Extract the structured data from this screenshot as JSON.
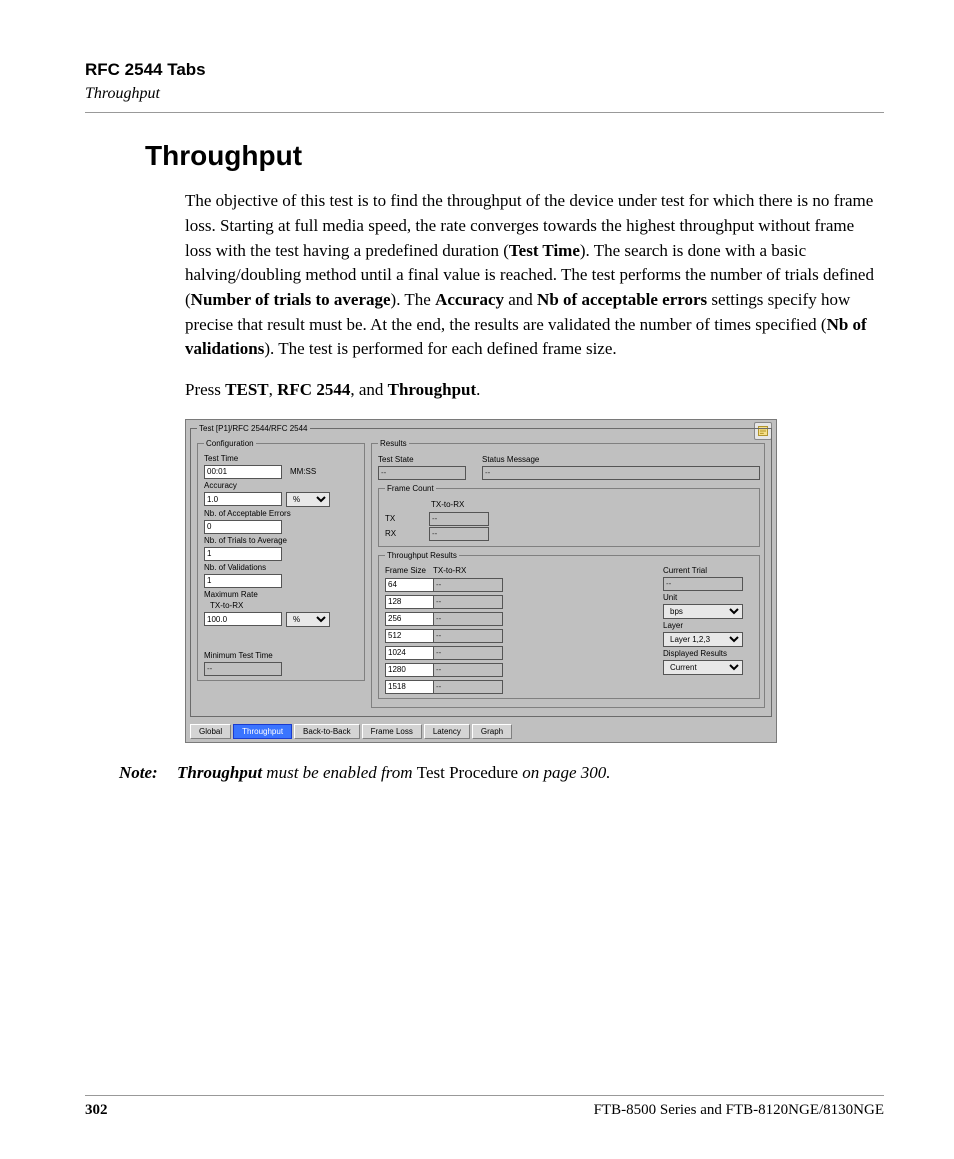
{
  "header": {
    "chapter": "RFC 2544 Tabs",
    "section": "Throughput"
  },
  "title": "Throughput",
  "paragraphs": {
    "p1_a": "The objective of this test is to find the throughput of the device under test for which there is no frame loss. Starting at full media speed, the rate converges towards the highest throughput without frame loss with the test having a predefined duration (",
    "p1_b": "Test Time",
    "p1_c": "). The search is done with a basic halving/doubling method until a final value is reached. The test performs the number of trials defined (",
    "p1_d": "Number of trials to average",
    "p1_e": "). The ",
    "p1_f": "Accuracy",
    "p1_g": " and ",
    "p1_h": "Nb of acceptable errors",
    "p1_i": " settings specify how precise that result must be. At the end, the results are validated the number of times specified (",
    "p1_j": "Nb of validations",
    "p1_k": "). The test is performed for each defined frame size.",
    "p2_a": "Press ",
    "p2_b": "TEST",
    "p2_c": ", ",
    "p2_d": "RFC 2544",
    "p2_e": ", and ",
    "p2_f": "Throughput",
    "p2_g": "."
  },
  "shot": {
    "window_legend": "Test [P1]/RFC 2544/RFC 2544",
    "config": {
      "legend": "Configuration",
      "test_time_label": "Test Time",
      "test_time_value": "00:01",
      "mmss": "MM:SS",
      "accuracy_label": "Accuracy",
      "accuracy_value": "1.0",
      "accuracy_unit": "%",
      "nb_err_label": "Nb. of Acceptable Errors",
      "nb_err_value": "0",
      "nb_trials_label": "Nb. of Trials to Average",
      "nb_trials_value": "1",
      "nb_valid_label": "Nb. of Validations",
      "nb_valid_value": "1",
      "max_rate_label": "Maximum Rate",
      "txrx_label": "TX-to-RX",
      "max_rate_value": "100.0",
      "max_rate_unit": "%",
      "min_test_time_label": "Minimum Test Time",
      "min_test_time_value": "--"
    },
    "results": {
      "legend": "Results",
      "test_state_label": "Test State",
      "test_state_value": "--",
      "status_msg_label": "Status Message",
      "status_msg_value": "--",
      "frame_count_legend": "Frame Count",
      "txrx_col": "TX-to-RX",
      "tx_label": "TX",
      "tx_value": "--",
      "rx_label": "RX",
      "rx_value": "--",
      "thr_legend": "Throughput Results",
      "frame_size_hd": "Frame Size",
      "frame_sizes": [
        "64",
        "128",
        "256",
        "512",
        "1024",
        "1280",
        "1518"
      ],
      "thr_values": [
        "--",
        "--",
        "--",
        "--",
        "--",
        "--",
        "--"
      ],
      "current_trial_label": "Current Trial",
      "current_trial_value": "--",
      "unit_label": "Unit",
      "unit_value": "bps",
      "layer_label": "Layer",
      "layer_value": "Layer 1,2,3",
      "disp_label": "Displayed Results",
      "disp_value": "Current"
    },
    "tabs": {
      "global": "Global",
      "throughput": "Throughput",
      "b2b": "Back-to-Back",
      "frame_loss": "Frame Loss",
      "latency": "Latency",
      "graph": "Graph"
    }
  },
  "note": {
    "label": "Note:",
    "bold_ital": "Throughput",
    "ital1": " must be enabled from ",
    "roman": "Test Procedure",
    "ital2": " on page 300."
  },
  "footer": {
    "page": "302",
    "doc": "FTB-8500 Series and FTB-8120NGE/8130NGE"
  }
}
